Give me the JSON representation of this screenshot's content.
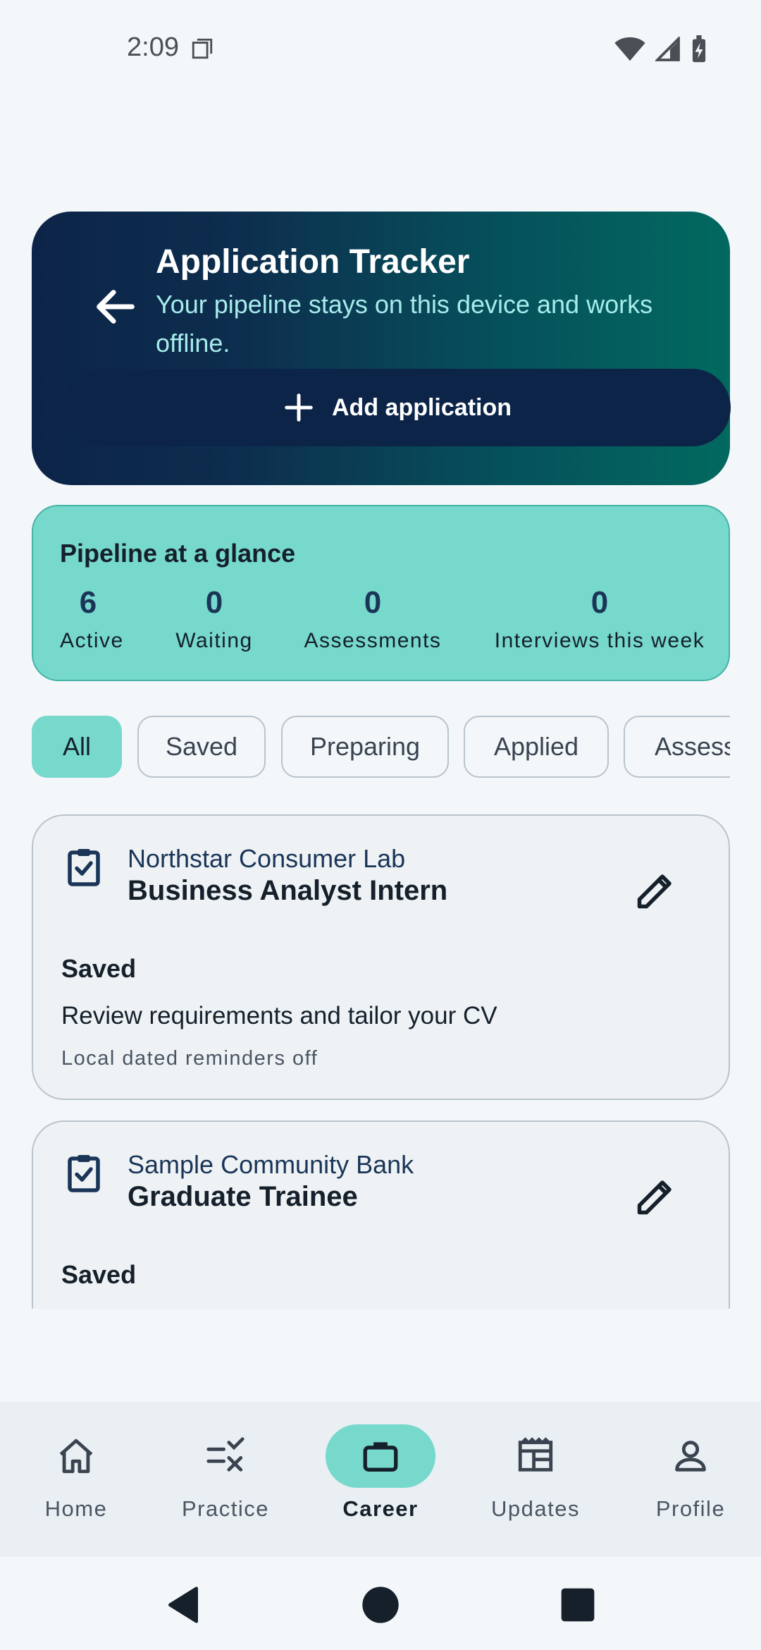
{
  "status_bar": {
    "time": "2:09"
  },
  "hero": {
    "title": "Application Tracker",
    "subtitle": "Your pipeline stays on this device and works offline.",
    "add_button_label": "Add application"
  },
  "pipeline": {
    "title": "Pipeline at a glance",
    "stats": [
      {
        "value": "6",
        "label": "Active"
      },
      {
        "value": "0",
        "label": "Waiting"
      },
      {
        "value": "0",
        "label": "Assessments"
      },
      {
        "value": "0",
        "label": "Interviews this week"
      }
    ]
  },
  "filters": {
    "selected": "All",
    "chips": [
      "All",
      "Saved",
      "Preparing",
      "Applied",
      "Assess"
    ]
  },
  "applications": [
    {
      "company": "Northstar Consumer Lab",
      "role": "Business Analyst Intern",
      "status": "Saved",
      "next_step": "Review requirements and tailor your CV",
      "reminder": "Local dated reminders off"
    },
    {
      "company": "Sample Community Bank",
      "role": "Graduate Trainee",
      "status": "Saved"
    }
  ],
  "bottom_nav": {
    "active": "Career",
    "items": [
      {
        "label": "Home",
        "icon": "home-icon"
      },
      {
        "label": "Practice",
        "icon": "practice-icon"
      },
      {
        "label": "Career",
        "icon": "briefcase-icon"
      },
      {
        "label": "Updates",
        "icon": "newspaper-icon"
      },
      {
        "label": "Profile",
        "icon": "person-icon"
      }
    ]
  },
  "colors": {
    "accent": "#77d8cc",
    "navy": "#0c2448",
    "teal": "#02695f",
    "subtitle": "#a7ecea"
  }
}
